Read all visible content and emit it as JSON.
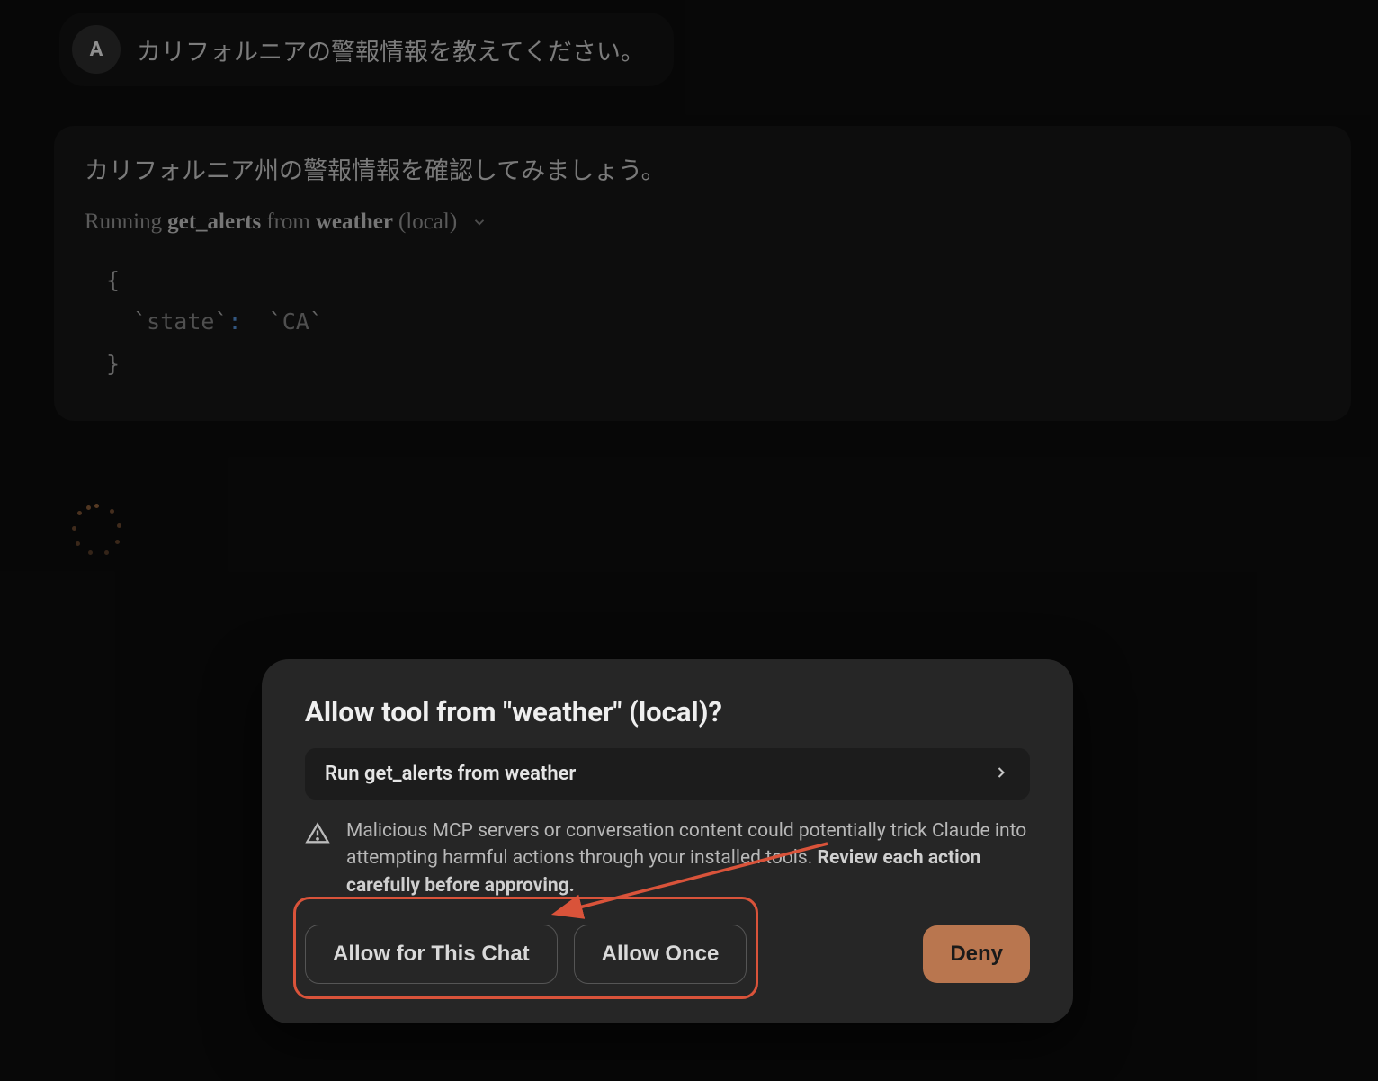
{
  "user": {
    "avatar_letter": "A",
    "message": "カリフォルニアの警報情報を教えてください。"
  },
  "assistant": {
    "intro": "カリフォルニア州の警報情報を確認してみましょう。",
    "tool_status": {
      "prefix": "Running ",
      "tool": "get_alerts",
      "mid": " from ",
      "server": "weather",
      "suffix": " (local)"
    },
    "code": {
      "open": "{",
      "key": "state",
      "value": "CA",
      "close": "}"
    }
  },
  "modal": {
    "title": "Allow tool from \"weather\" (local)?",
    "detail_row": "Run get_alerts from weather",
    "warning_plain": "Malicious MCP servers or conversation content could potentially trick Claude into attempting harmful actions through your installed tools. ",
    "warning_bold": "Review each action carefully before approving.",
    "buttons": {
      "allow_chat": "Allow for This Chat",
      "allow_once": "Allow Once",
      "deny": "Deny"
    }
  }
}
